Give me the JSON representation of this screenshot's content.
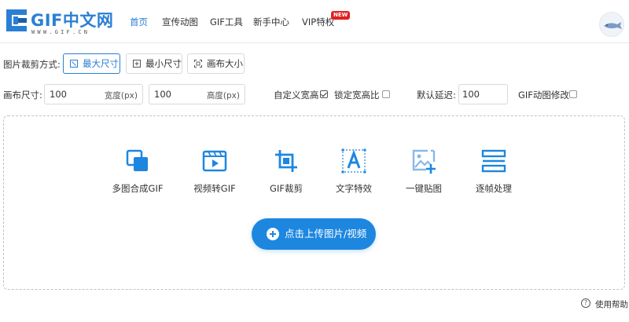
{
  "header": {
    "logo_text": "GIF中文网",
    "logo_sub": "WWW.GIF.CN",
    "nav": [
      {
        "label": "首页"
      },
      {
        "label": "宣传动图"
      },
      {
        "label": "GIF工具"
      },
      {
        "label": "新手中心"
      },
      {
        "label": "VIP特权"
      }
    ],
    "badge": "NEW",
    "accent": "#2a7fd4"
  },
  "crop": {
    "label": "图片裁剪方式:",
    "modes": [
      {
        "label": "最大尺寸",
        "icon": "max-size-icon"
      },
      {
        "label": "最小尺寸",
        "icon": "min-size-icon"
      },
      {
        "label": "画布大小",
        "icon": "canvas-size-icon"
      }
    ],
    "selected": "最大尺寸"
  },
  "size": {
    "canvas_label": "画布尺寸:",
    "width_value": "100",
    "width_suffix": "宽度(px)",
    "height_value": "100",
    "height_suffix": "高度(px)",
    "custom_ratio_label": "自定义宽高",
    "custom_ratio_checked": true,
    "lock_ratio_label": "锁定宽高比",
    "lock_ratio_checked": false,
    "delay_label": "默认延迟:",
    "delay_value": "100",
    "gif_edit_label": "GIF动图修改",
    "gif_edit_checked": false
  },
  "tools": [
    {
      "label": "多图合成GIF",
      "icon": "merge-images-icon"
    },
    {
      "label": "视频转GIF",
      "icon": "video-play-icon"
    },
    {
      "label": "GIF裁剪",
      "icon": "crop-icon"
    },
    {
      "label": "文字特效",
      "icon": "text-effect-icon"
    },
    {
      "label": "一键贴图",
      "icon": "add-image-icon"
    },
    {
      "label": "逐帧处理",
      "icon": "frames-icon"
    }
  ],
  "upload_label": "点击上传图片/视频",
  "help_label": "使用帮助",
  "colors": {
    "primary": "#1d87e0",
    "icon_blue": "#1d87e0",
    "border": "#d9d9d9"
  }
}
